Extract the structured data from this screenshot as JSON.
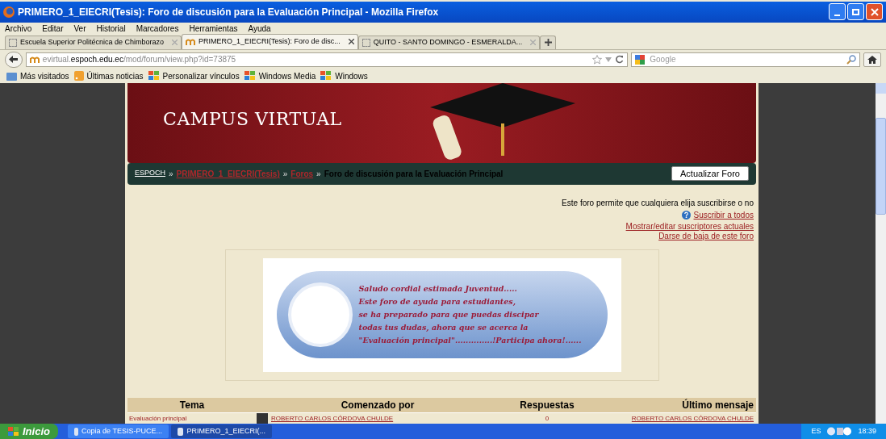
{
  "window": {
    "title": "PRIMERO_1_EIECRI(Tesis): Foro de discusión para la Evaluación Principal - Mozilla Firefox"
  },
  "menu": [
    "Archivo",
    "Editar",
    "Ver",
    "Historial",
    "Marcadores",
    "Herramientas",
    "Ayuda"
  ],
  "tabs": [
    {
      "label": "Escuela Superior Politécnica de Chimborazo",
      "selected": false,
      "kind": "blank"
    },
    {
      "label": "PRIMERO_1_EIECRI(Tesis): Foro de disc...",
      "selected": true,
      "kind": "moodle"
    },
    {
      "label": "QUITO - SANTO DOMINGO - ESMERALDA...",
      "selected": false,
      "kind": "blank"
    }
  ],
  "address": {
    "host_prefix": "evirtual.",
    "host": "espoch.edu.ec",
    "path": "/mod/forum/view.php?id=73875"
  },
  "search": {
    "placeholder": "Google"
  },
  "bookmarks": [
    {
      "label": "Más visitados",
      "kind": "folder"
    },
    {
      "label": "Últimas noticias",
      "kind": "feed"
    },
    {
      "label": "Personalizar vínculos",
      "kind": "windows"
    },
    {
      "label": "Windows Media",
      "kind": "windows"
    },
    {
      "label": "Windows",
      "kind": "windows"
    }
  ],
  "header": {
    "title": "CAMPUS VIRTUAL"
  },
  "breadcrumb": [
    {
      "label": "ESPOCH",
      "kind": "home"
    },
    {
      "label": "PRIMERO_1_EIECRI(Tesis)",
      "kind": "link"
    },
    {
      "label": "Foros",
      "kind": "link"
    },
    {
      "label": "Foro de discusión para la Evaluación Principal",
      "kind": "current"
    }
  ],
  "breadcrumb_separator": "»",
  "update_button": "Actualizar Foro",
  "subscription": {
    "note": "Este foro permite que cualquiera elija suscribirse o no",
    "links": [
      "Suscribir a todos",
      "Mostrar/editar suscriptores actuales",
      "Darse de baja de este foro"
    ]
  },
  "banner_lines": [
    "Saludo cordial estimada Juventud.....",
    "Este foro de ayuda para estudiantes,",
    "se ha preparado para que puedas discipar",
    "todas tus dudas, ahora que se acerca la",
    "\"Evaluación principal\"..............!Participa ahora!......"
  ],
  "table": {
    "columns": [
      "Tema",
      "Comenzado por",
      "Respuestas",
      "Último mensaje"
    ],
    "rows": [
      {
        "topic": "Evaluación principal",
        "author": "ROBERTO CARLOS CÓRDOVA CHULDE",
        "replies": "0",
        "last": "ROBERTO CARLOS CÓRDOVA CHULDE"
      }
    ]
  },
  "taskbar": {
    "start": "Inicio",
    "tasks": [
      {
        "label": "Copia de TESIS-PUCE...",
        "selected": false
      },
      {
        "label": "PRIMERO_1_EIECRI(...",
        "selected": true
      }
    ],
    "language": "ES",
    "clock": "18:39"
  }
}
